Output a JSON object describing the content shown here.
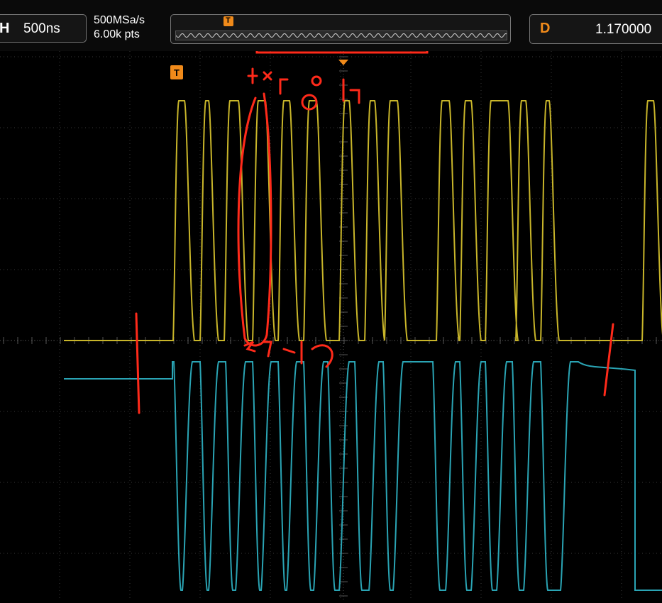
{
  "toolbar": {
    "h_icon": "H",
    "timebase": "500ns",
    "sample_rate": "500MSa/s",
    "memory_depth": "6.00k pts",
    "trigger_marker": "T",
    "delay_icon": "D",
    "delay_value": "1.170000"
  },
  "screen": {
    "trigger_position_marker": "T",
    "colors": {
      "channel1": "#c8b52a",
      "channel2": "#2aa4b4",
      "grid": "#3a3a3a",
      "annotation": "#ff2a1a",
      "trigger_marker": "#f08a1a"
    }
  }
}
